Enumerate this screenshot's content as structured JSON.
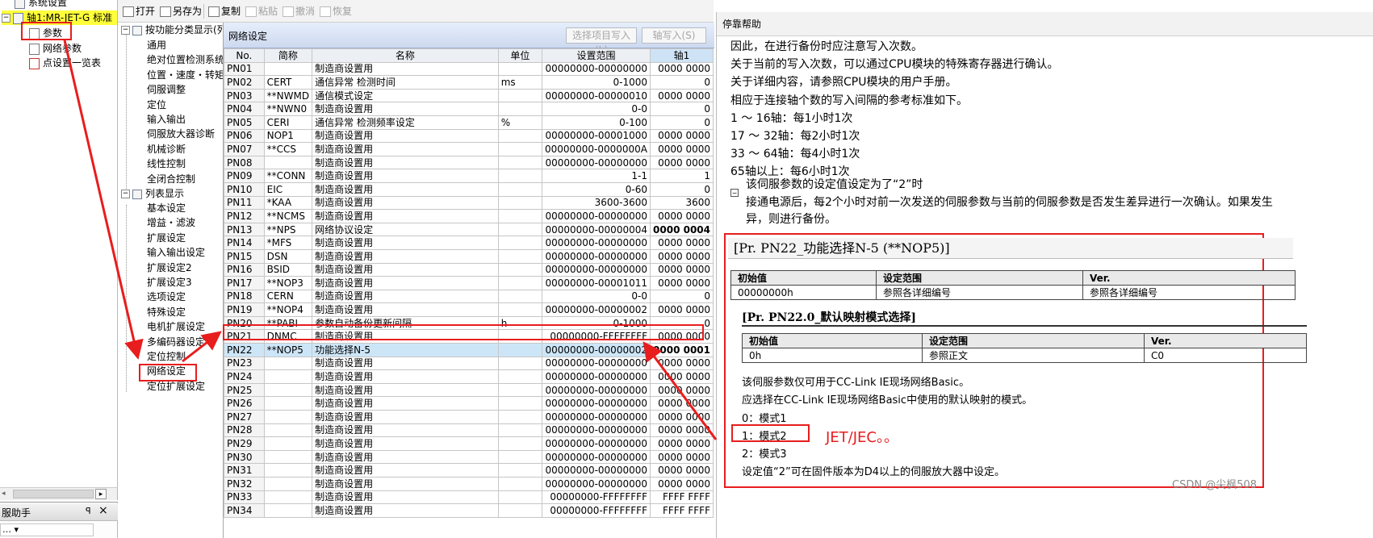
{
  "project_tree": {
    "items": [
      {
        "label": "系统设置",
        "icon": "gear-icon",
        "indent": 1
      },
      {
        "label": "轴1:MR-JET-G 标准",
        "icon": "servo-amplifier-icon",
        "indent": 0,
        "expanded": true
      },
      {
        "label": "参数",
        "icon": "document-icon",
        "indent": 2
      },
      {
        "label": "网络参数",
        "icon": "document-icon",
        "indent": 2
      },
      {
        "label": "点设置一览表",
        "icon": "table-icon",
        "indent": 2
      }
    ],
    "assist_title": "服助手",
    "assist_pin": "ꟼ",
    "assist_close": "×",
    "assist_row": "… ▾"
  },
  "toolbar": {
    "open": "打开",
    "save_as": "另存为",
    "copy": "复制",
    "paste": "粘贴",
    "undo": "撤消",
    "redo": "恢复"
  },
  "category_tree": {
    "group1": "按功能分类显示(列",
    "group1_items": [
      "通用",
      "绝对位置检测系统",
      "位置・速度・转矩",
      "伺服调整",
      "定位",
      "输入输出",
      "伺服放大器诊断",
      "机械诊断",
      "线性控制",
      "全闭合控制"
    ],
    "group2": "列表显示",
    "group2_items": [
      "基本设定",
      "增益・滤波",
      "扩展设定",
      "输入输出设定",
      "扩展设定2",
      "扩展设定3",
      "选项设定",
      "特殊设定",
      "电机扩展设定",
      "多编码器设定",
      "定位控制",
      "网络设定",
      "定位扩展设定"
    ]
  },
  "param_panel": {
    "title": "网络设定",
    "write_selected": "选择项目写入(L)",
    "axis_write": "轴写入(S)",
    "columns": {
      "no": "No.",
      "abbr": "简称",
      "name": "名称",
      "unit": "单位",
      "range": "设置范围",
      "axis1": "轴1"
    },
    "rows": [
      {
        "no": "PN01",
        "abbr": "",
        "name": "制造商设置用",
        "unit": "",
        "range": "00000000-00000000",
        "value": "0000 0000"
      },
      {
        "no": "PN02",
        "abbr": "CERT",
        "name": "通信异常 检测时间",
        "unit": "ms",
        "range": "0-1000",
        "value": "0"
      },
      {
        "no": "PN03",
        "abbr": "**NWMD",
        "name": "通信模式设定",
        "unit": "",
        "range": "00000000-00000010",
        "value": "0000 0000"
      },
      {
        "no": "PN04",
        "abbr": "**NWN0",
        "name": "制造商设置用",
        "unit": "",
        "range": "0-0",
        "value": "0"
      },
      {
        "no": "PN05",
        "abbr": "CERI",
        "name": "通信异常 检测频率设定",
        "unit": "%",
        "range": "0-100",
        "value": "0"
      },
      {
        "no": "PN06",
        "abbr": "NOP1",
        "name": "制造商设置用",
        "unit": "",
        "range": "00000000-00001000",
        "value": "0000 0000"
      },
      {
        "no": "PN07",
        "abbr": "**CCS",
        "name": "制造商设置用",
        "unit": "",
        "range": "00000000-0000000A",
        "value": "0000 0000"
      },
      {
        "no": "PN08",
        "abbr": "",
        "name": "制造商设置用",
        "unit": "",
        "range": "00000000-00000000",
        "value": "0000 0000"
      },
      {
        "no": "PN09",
        "abbr": "**CONN",
        "name": "制造商设置用",
        "unit": "",
        "range": "1-1",
        "value": "1"
      },
      {
        "no": "PN10",
        "abbr": "EIC",
        "name": "制造商设置用",
        "unit": "",
        "range": "0-60",
        "value": "0"
      },
      {
        "no": "PN11",
        "abbr": "*KAA",
        "name": "制造商设置用",
        "unit": "",
        "range": "3600-3600",
        "value": "3600"
      },
      {
        "no": "PN12",
        "abbr": "**NCMS",
        "name": "制造商设置用",
        "unit": "",
        "range": "00000000-00000000",
        "value": "0000 0000"
      },
      {
        "no": "PN13",
        "abbr": "**NPS",
        "name": "网络协议设定",
        "unit": "",
        "range": "00000000-00000004",
        "value": "0000 0004",
        "bold": true
      },
      {
        "no": "PN14",
        "abbr": "*MFS",
        "name": "制造商设置用",
        "unit": "",
        "range": "00000000-00000000",
        "value": "0000 0000"
      },
      {
        "no": "PN15",
        "abbr": "DSN",
        "name": "制造商设置用",
        "unit": "",
        "range": "00000000-00000000",
        "value": "0000 0000"
      },
      {
        "no": "PN16",
        "abbr": "BSID",
        "name": "制造商设置用",
        "unit": "",
        "range": "00000000-00000000",
        "value": "0000 0000"
      },
      {
        "no": "PN17",
        "abbr": "**NOP3",
        "name": "制造商设置用",
        "unit": "",
        "range": "00000000-00001011",
        "value": "0000 0000"
      },
      {
        "no": "PN18",
        "abbr": "CERN",
        "name": "制造商设置用",
        "unit": "",
        "range": "0-0",
        "value": "0"
      },
      {
        "no": "PN19",
        "abbr": "**NOP4",
        "name": "制造商设置用",
        "unit": "",
        "range": "00000000-00000002",
        "value": "0000 0000"
      },
      {
        "no": "PN20",
        "abbr": "**PABI",
        "name": "参数自动备份更新间隔",
        "unit": "h",
        "range": "0-1000",
        "value": "0"
      },
      {
        "no": "PN21",
        "abbr": "DNMC",
        "name": "制造商设置用",
        "unit": "",
        "range": "00000000-FFFFFFFF",
        "value": "0000 0000"
      },
      {
        "no": "PN22",
        "abbr": "**NOP5",
        "name": "功能选择N-5",
        "unit": "",
        "range": "00000000-00000002",
        "value": "0000 0001",
        "bold": true,
        "selected": true
      },
      {
        "no": "PN23",
        "abbr": "",
        "name": "制造商设置用",
        "unit": "",
        "range": "00000000-00000000",
        "value": "0000 0000"
      },
      {
        "no": "PN24",
        "abbr": "",
        "name": "制造商设置用",
        "unit": "",
        "range": "00000000-00000000",
        "value": "0000 0000"
      },
      {
        "no": "PN25",
        "abbr": "",
        "name": "制造商设置用",
        "unit": "",
        "range": "00000000-00000000",
        "value": "0000 0000"
      },
      {
        "no": "PN26",
        "abbr": "",
        "name": "制造商设置用",
        "unit": "",
        "range": "00000000-00000000",
        "value": "0000 0000"
      },
      {
        "no": "PN27",
        "abbr": "",
        "name": "制造商设置用",
        "unit": "",
        "range": "00000000-00000000",
        "value": "0000 0000"
      },
      {
        "no": "PN28",
        "abbr": "",
        "name": "制造商设置用",
        "unit": "",
        "range": "00000000-00000000",
        "value": "0000 0000"
      },
      {
        "no": "PN29",
        "abbr": "",
        "name": "制造商设置用",
        "unit": "",
        "range": "00000000-00000000",
        "value": "0000 0000"
      },
      {
        "no": "PN30",
        "abbr": "",
        "name": "制造商设置用",
        "unit": "",
        "range": "00000000-00000000",
        "value": "0000 0000"
      },
      {
        "no": "PN31",
        "abbr": "",
        "name": "制造商设置用",
        "unit": "",
        "range": "00000000-00000000",
        "value": "0000 0000"
      },
      {
        "no": "PN32",
        "abbr": "",
        "name": "制造商设置用",
        "unit": "",
        "range": "00000000-00000000",
        "value": "0000 0000"
      },
      {
        "no": "PN33",
        "abbr": "",
        "name": "制造商设置用",
        "unit": "",
        "range": "00000000-FFFFFFFF",
        "value": "FFFF FFFF"
      },
      {
        "no": "PN34",
        "abbr": "",
        "name": "制造商设置用",
        "unit": "",
        "range": "00000000-FFFFFFFF",
        "value": "FFFF FFFF"
      }
    ]
  },
  "help": {
    "title": "停靠帮助",
    "lines": [
      "因此，在进行备份时应注意写入次数。",
      "关于当前的写入次数，可以通过CPU模块的特殊寄存器进行确认。",
      "关于详细内容，请参照CPU模块的用户手册。",
      "相应于连接轴个数的写入间隔的参考标准如下。",
      "1 ～ 16轴：每1小时1次",
      "17 ～ 32轴：每2小时1次",
      "33 ～ 64轴：每4小时1次",
      "65轴以上：每6小时1次"
    ],
    "bullet_title": "该伺服参数的设定值设定为了“2”时",
    "bullet_body1": "接通电源后，每2个小时对前一次发送的伺服参数与当前的伺服参数是否发生差异进行一次确认。如果发生",
    "bullet_body2": "异，则进行备份。",
    "pr_heading": "[Pr. PN22_功能选择N-5 (**NOP5)]",
    "table1": {
      "headers": [
        "初始值",
        "设定范围",
        "Ver."
      ],
      "row": [
        "00000000h",
        "参照各详细编号",
        "参照各详细编号"
      ]
    },
    "sub_heading": "[Pr. PN22.0_默认映射模式选择]",
    "table2": {
      "headers": [
        "初始值",
        "设定范围",
        "Ver."
      ],
      "row": [
        "0h",
        "参照正文",
        "C0"
      ]
    },
    "body": [
      "该伺服参数仅可用于CC-Link IE现场网络Basic。",
      "应选择在CC-Link IE现场网络Basic中使用的默认映射的模式。"
    ],
    "modes": [
      "0：模式1",
      "1：模式2",
      "2：模式3"
    ],
    "footer": "设定值“2”可在固件版本为D4以上的伺服放大器中设定。"
  },
  "annotation": {
    "note": "JET/JEC。。",
    "color": "#e81d1d"
  },
  "watermark": "CSDN @尖枫508"
}
